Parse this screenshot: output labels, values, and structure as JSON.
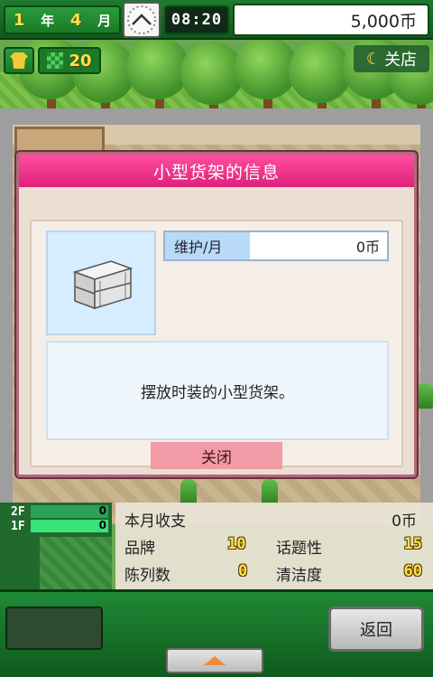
{
  "hud": {
    "year_num": "1",
    "year_unit": "年",
    "month_num": "4",
    "month_unit": "月",
    "time": "08:20",
    "money": "5,000币",
    "stock_count": "20",
    "close_shop_label": "关店"
  },
  "dialog": {
    "title": "小型货架的信息",
    "maintenance_label": "维护/月",
    "maintenance_value": "0币",
    "description": "摆放时装的小型货架。",
    "close_label": "关闭"
  },
  "floors": [
    {
      "label": "2F",
      "count": "0"
    },
    {
      "label": "1F",
      "count": "0"
    }
  ],
  "stats": {
    "monthly_income_label": "本月收支",
    "monthly_income_value": "0币",
    "brand_label": "品牌",
    "brand_value": "10",
    "topic_label": "话题性",
    "topic_value": "15",
    "display_label": "陈列数",
    "display_value": "0",
    "clean_label": "清洁度",
    "clean_value": "60"
  },
  "bottom": {
    "back_label": "返回"
  },
  "icons": {
    "clock": "clock-icon",
    "shirt": "shirt-icon",
    "moon": "moon-icon",
    "shelf": "shelf-icon",
    "expand": "triangle-up-icon"
  }
}
